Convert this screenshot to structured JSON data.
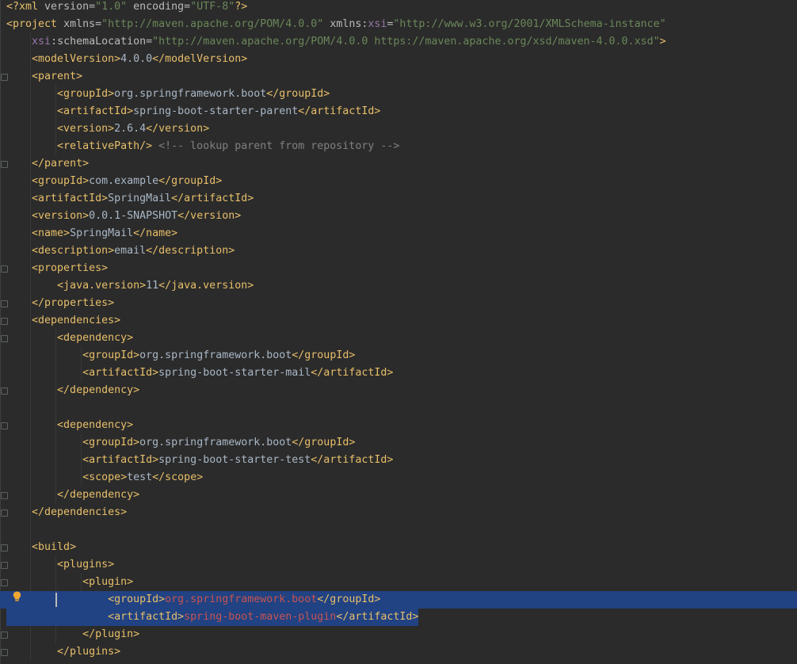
{
  "editor": {
    "lines": [
      {
        "indent": "",
        "parts": [
          {
            "t": "<?xml ",
            "c": "pi"
          },
          {
            "t": "version=",
            "c": "attr"
          },
          {
            "t": "\"1.0\"",
            "c": "val"
          },
          {
            "t": " encoding=",
            "c": "attr"
          },
          {
            "t": "\"UTF-8\"",
            "c": "val"
          },
          {
            "t": "?>",
            "c": "pi"
          }
        ]
      },
      {
        "indent": "",
        "parts": [
          {
            "t": "<project ",
            "c": "tag"
          },
          {
            "t": "xmlns=",
            "c": "attr"
          },
          {
            "t": "\"http://maven.apache.org/POM/4.0.0\"",
            "c": "val"
          },
          {
            "t": " xmlns:",
            "c": "attr"
          },
          {
            "t": "xsi",
            "c": "ns"
          },
          {
            "t": "=",
            "c": "attr"
          },
          {
            "t": "\"http://www.w3.org/2001/XMLSchema-instance\"",
            "c": "val"
          }
        ]
      },
      {
        "indent": "    ",
        "parts": [
          {
            "t": "xsi",
            "c": "ns"
          },
          {
            "t": ":schemaLocation=",
            "c": "attr"
          },
          {
            "t": "\"http://maven.apache.org/POM/4.0.0 https://maven.apache.org/xsd/maven-4.0.0.xsd\"",
            "c": "val"
          },
          {
            "t": ">",
            "c": "tag"
          }
        ]
      },
      {
        "indent": "    ",
        "parts": [
          {
            "t": "<modelVersion>",
            "c": "tag"
          },
          {
            "t": "4.0.0",
            "c": "txt"
          },
          {
            "t": "</modelVersion>",
            "c": "tag"
          }
        ]
      },
      {
        "indent": "    ",
        "parts": [
          {
            "t": "<parent>",
            "c": "tag"
          }
        ]
      },
      {
        "indent": "        ",
        "parts": [
          {
            "t": "<groupId>",
            "c": "tag"
          },
          {
            "t": "org.springframework.boot",
            "c": "txt"
          },
          {
            "t": "</groupId>",
            "c": "tag"
          }
        ]
      },
      {
        "indent": "        ",
        "parts": [
          {
            "t": "<artifactId>",
            "c": "tag"
          },
          {
            "t": "spring-boot-starter-parent",
            "c": "txt"
          },
          {
            "t": "</artifactId>",
            "c": "tag"
          }
        ]
      },
      {
        "indent": "        ",
        "parts": [
          {
            "t": "<version>",
            "c": "tag"
          },
          {
            "t": "2.6.4",
            "c": "txt"
          },
          {
            "t": "</version>",
            "c": "tag"
          }
        ]
      },
      {
        "indent": "        ",
        "parts": [
          {
            "t": "<relativePath/>",
            "c": "tag"
          },
          {
            "t": " <!-- lookup parent from repository -->",
            "c": "cmt"
          }
        ]
      },
      {
        "indent": "    ",
        "parts": [
          {
            "t": "</parent>",
            "c": "tag"
          }
        ]
      },
      {
        "indent": "    ",
        "parts": [
          {
            "t": "<groupId>",
            "c": "tag"
          },
          {
            "t": "com.example",
            "c": "txt"
          },
          {
            "t": "</groupId>",
            "c": "tag"
          }
        ]
      },
      {
        "indent": "    ",
        "parts": [
          {
            "t": "<artifactId>",
            "c": "tag"
          },
          {
            "t": "SpringMail",
            "c": "txt"
          },
          {
            "t": "</artifactId>",
            "c": "tag"
          }
        ]
      },
      {
        "indent": "    ",
        "parts": [
          {
            "t": "<version>",
            "c": "tag"
          },
          {
            "t": "0.0.1-SNAPSHOT",
            "c": "txt"
          },
          {
            "t": "</version>",
            "c": "tag"
          }
        ]
      },
      {
        "indent": "    ",
        "parts": [
          {
            "t": "<name>",
            "c": "tag"
          },
          {
            "t": "SpringMail",
            "c": "txt"
          },
          {
            "t": "</name>",
            "c": "tag"
          }
        ]
      },
      {
        "indent": "    ",
        "parts": [
          {
            "t": "<description>",
            "c": "tag"
          },
          {
            "t": "email",
            "c": "txt"
          },
          {
            "t": "</description>",
            "c": "tag"
          }
        ]
      },
      {
        "indent": "    ",
        "parts": [
          {
            "t": "<properties>",
            "c": "tag"
          }
        ]
      },
      {
        "indent": "        ",
        "parts": [
          {
            "t": "<java.version>",
            "c": "tag"
          },
          {
            "t": "11",
            "c": "txt"
          },
          {
            "t": "</java.version>",
            "c": "tag"
          }
        ]
      },
      {
        "indent": "    ",
        "parts": [
          {
            "t": "</properties>",
            "c": "tag"
          }
        ]
      },
      {
        "indent": "    ",
        "parts": [
          {
            "t": "<dependencies>",
            "c": "tag"
          }
        ]
      },
      {
        "indent": "        ",
        "parts": [
          {
            "t": "<dependency>",
            "c": "tag"
          }
        ]
      },
      {
        "indent": "            ",
        "parts": [
          {
            "t": "<groupId>",
            "c": "tag"
          },
          {
            "t": "org.springframework.boot",
            "c": "txt"
          },
          {
            "t": "</groupId>",
            "c": "tag"
          }
        ]
      },
      {
        "indent": "            ",
        "parts": [
          {
            "t": "<artifactId>",
            "c": "tag"
          },
          {
            "t": "spring-boot-starter-mail",
            "c": "txt"
          },
          {
            "t": "</artifactId>",
            "c": "tag"
          }
        ]
      },
      {
        "indent": "        ",
        "parts": [
          {
            "t": "</dependency>",
            "c": "tag"
          }
        ]
      },
      {
        "indent": "",
        "parts": []
      },
      {
        "indent": "        ",
        "parts": [
          {
            "t": "<dependency>",
            "c": "tag"
          }
        ]
      },
      {
        "indent": "            ",
        "parts": [
          {
            "t": "<groupId>",
            "c": "tag"
          },
          {
            "t": "org.springframework.boot",
            "c": "txt"
          },
          {
            "t": "</groupId>",
            "c": "tag"
          }
        ]
      },
      {
        "indent": "            ",
        "parts": [
          {
            "t": "<artifactId>",
            "c": "tag"
          },
          {
            "t": "spring-boot-starter-test",
            "c": "txt"
          },
          {
            "t": "</artifactId>",
            "c": "tag"
          }
        ]
      },
      {
        "indent": "            ",
        "parts": [
          {
            "t": "<scope>",
            "c": "tag"
          },
          {
            "t": "test",
            "c": "txt"
          },
          {
            "t": "</scope>",
            "c": "tag"
          }
        ]
      },
      {
        "indent": "        ",
        "parts": [
          {
            "t": "</dependency>",
            "c": "tag"
          }
        ]
      },
      {
        "indent": "    ",
        "parts": [
          {
            "t": "</dependencies>",
            "c": "tag"
          }
        ]
      },
      {
        "indent": "",
        "parts": []
      },
      {
        "indent": "    ",
        "parts": [
          {
            "t": "<build>",
            "c": "tag"
          }
        ]
      },
      {
        "indent": "        ",
        "parts": [
          {
            "t": "<plugins>",
            "c": "tag"
          }
        ]
      },
      {
        "indent": "            ",
        "parts": [
          {
            "t": "<plugin>",
            "c": "tag"
          }
        ]
      },
      {
        "indent": "                ",
        "selected": "full",
        "parts": [
          {
            "t": "<groupId>",
            "c": "tag"
          },
          {
            "t": "org.springframework.boot",
            "c": "hl"
          },
          {
            "t": "</groupId>",
            "c": "tag"
          }
        ]
      },
      {
        "indent": "                ",
        "selected": "partial",
        "parts": [
          {
            "t": "<artifactId>",
            "c": "tag"
          },
          {
            "t": "spring-boot-maven-plugin",
            "c": "hl"
          },
          {
            "t": "</artifactId>",
            "c": "tag"
          }
        ]
      },
      {
        "indent": "            ",
        "parts": [
          {
            "t": "</plugin>",
            "c": "tag"
          }
        ]
      },
      {
        "indent": "        ",
        "parts": [
          {
            "t": "</plugins>",
            "c": "tag"
          }
        ]
      }
    ],
    "intention_icon": "lightbulb-icon"
  }
}
